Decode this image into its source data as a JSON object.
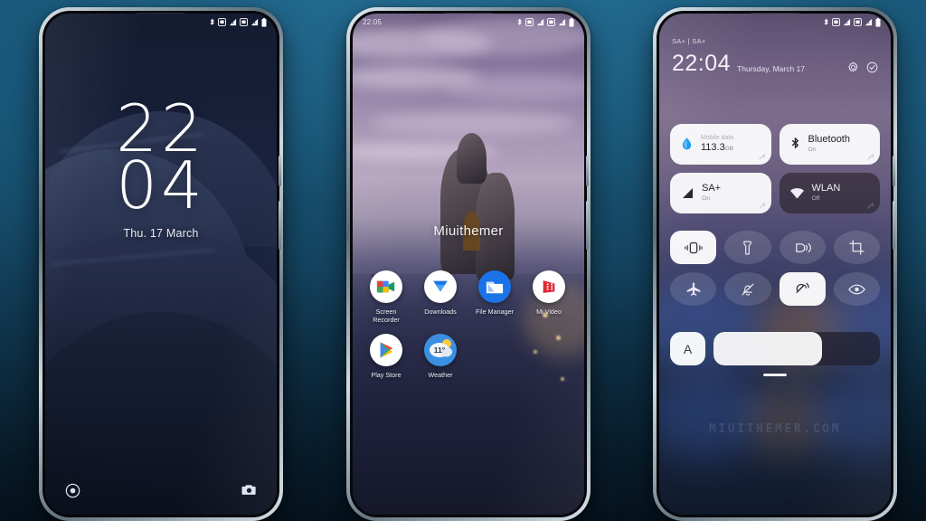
{
  "background": {
    "top_color": "#1d6b92",
    "bottom_color": "#06141f"
  },
  "phones": {
    "lock_screen": {
      "name": "Lock screen",
      "statusbar": {
        "time": "",
        "icons": [
          "bluetooth-icon",
          "sim1-icon",
          "signal1-icon",
          "sim2-icon",
          "signal2-icon",
          "battery-icon"
        ]
      },
      "clock": {
        "hours": "22",
        "minutes": "04",
        "date": "Thu. 17 March"
      },
      "bottom_shortcuts": [
        {
          "name": "assistant-shortcut",
          "icon": "circle-ring-icon"
        },
        {
          "name": "camera-shortcut",
          "icon": "camera-icon"
        }
      ]
    },
    "home_screen": {
      "name": "Home screen",
      "statusbar": {
        "time": "22:05",
        "icons": [
          "bluetooth-icon",
          "sim1-icon",
          "signal1-icon",
          "sim2-icon",
          "signal2-icon",
          "battery-icon"
        ]
      },
      "wallpaper_text": "Miuithemer",
      "apps_row1": [
        {
          "label": "Screen Recorder",
          "icon": "screen-recorder-icon"
        },
        {
          "label": "Downloads",
          "icon": "downloads-icon"
        },
        {
          "label": "File Manager",
          "icon": "file-manager-icon"
        },
        {
          "label": "Mi Video",
          "icon": "mi-video-icon"
        }
      ],
      "apps_row2": [
        {
          "label": "Play Store",
          "icon": "play-store-icon"
        },
        {
          "label": "Weather",
          "icon": "weather-icon",
          "temperature": "11°"
        }
      ]
    },
    "control_center": {
      "name": "Control center",
      "statusbar": {
        "carrier": "SA+ | SA+",
        "icons": [
          "bluetooth-icon",
          "sim1-icon",
          "signal1-icon",
          "sim2-icon",
          "signal2-icon",
          "battery-icon"
        ]
      },
      "header": {
        "time": "22:04",
        "date": "Thursday, March 17",
        "actions": [
          {
            "name": "settings-button",
            "icon": "gear-icon"
          },
          {
            "name": "edit-tiles-button",
            "icon": "check-circle-icon"
          }
        ]
      },
      "tiles": [
        {
          "title": "Mobile data",
          "value": "113.3",
          "unit": "GB",
          "state": "on",
          "icon": "data-drop-icon"
        },
        {
          "title": "Bluetooth",
          "sub": "On",
          "state": "on",
          "icon": "bluetooth-icon"
        },
        {
          "title": "SA+",
          "sub": "On",
          "state": "on",
          "icon": "signal-icon"
        },
        {
          "title": "WLAN",
          "sub": "Off",
          "state": "off",
          "icon": "wifi-icon"
        }
      ],
      "toggles_row1": [
        {
          "name": "vibrate-toggle",
          "icon": "vibrate-icon",
          "state": "active"
        },
        {
          "name": "flashlight-toggle",
          "icon": "flashlight-icon",
          "state": "inactive"
        },
        {
          "name": "cast-toggle",
          "icon": "cast-sound-icon",
          "state": "inactive"
        },
        {
          "name": "screenshot-toggle",
          "icon": "crop-icon",
          "state": "inactive"
        }
      ],
      "toggles_row2": [
        {
          "name": "airplane-toggle",
          "icon": "airplane-icon",
          "state": "inactive"
        },
        {
          "name": "dnd-toggle",
          "icon": "bell-off-icon",
          "state": "inactive"
        },
        {
          "name": "location-toggle",
          "icon": "location-icon",
          "state": "active"
        },
        {
          "name": "reading-mode-toggle",
          "icon": "eye-icon",
          "state": "inactive"
        }
      ],
      "brightness": {
        "auto_label": "A",
        "level_percent": 65
      },
      "watermark": "MIUITHEMER.COM"
    }
  }
}
